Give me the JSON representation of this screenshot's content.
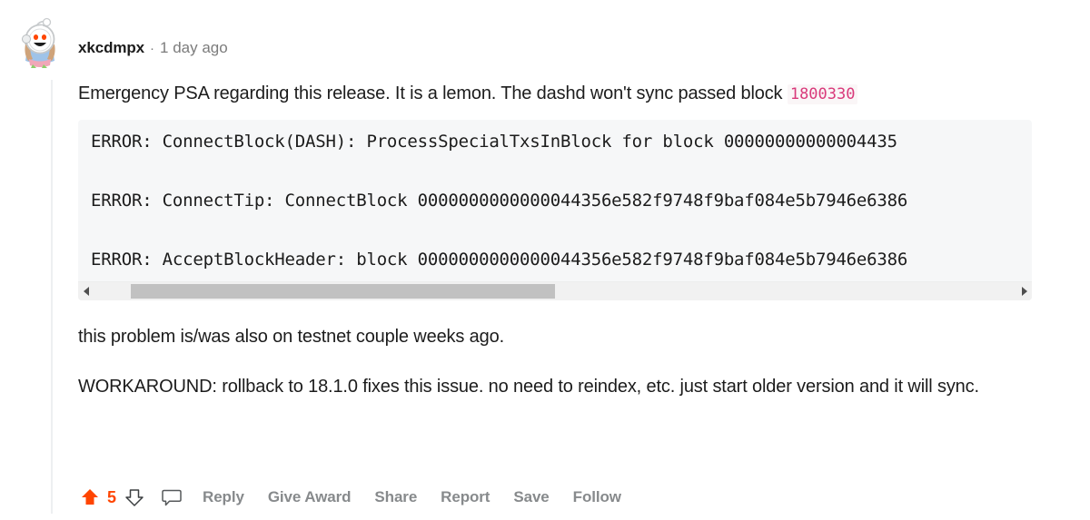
{
  "comment": {
    "author": "xkcdmpx",
    "separator": "·",
    "timestamp": "1 day ago",
    "avatar_icon": "reddit-snoo-astronaut-avatar",
    "paragraphs": {
      "p1_before_code": "Emergency PSA regarding this release. It is a lemon. The dashd won't sync passed block ",
      "p1_inline_code": "1800330",
      "p2": "this problem is/was also on testnet couple weeks ago.",
      "p3": "WORKAROUND: rollback to 18.1.0 fixes this issue. no need to reindex, etc. just start older version and it will sync."
    },
    "code_block": {
      "lines": [
        "ERROR: ConnectBlock(DASH): ProcessSpecialTxsInBlock for block 00000000000004435",
        "ERROR: ConnectTip: ConnectBlock 0000000000000044356e582f9748f9baf084e5b7946e6386",
        "ERROR: AcceptBlockHeader: block 0000000000000044356e582f9748f9baf084e5b7946e6386"
      ],
      "scrollbar": {
        "left_arrow_icon": "scroll-left-arrow-icon",
        "right_arrow_icon": "scroll-right-arrow-icon",
        "thumb_position_percent": 4,
        "thumb_width_percent": 46
      }
    },
    "actions": {
      "upvote_icon": "upvote-arrow-icon",
      "downvote_icon": "downvote-arrow-icon",
      "comment_icon": "comment-bubble-icon",
      "score": "5",
      "links": [
        "Reply",
        "Give Award",
        "Share",
        "Report",
        "Save",
        "Follow"
      ]
    },
    "colors": {
      "upvote_orange": "#ff4500",
      "inline_code_pink": "#d93a7b",
      "code_block_bg": "#f6f7f8",
      "action_gray": "#878a8c",
      "thread_line": "#edeff1"
    }
  }
}
